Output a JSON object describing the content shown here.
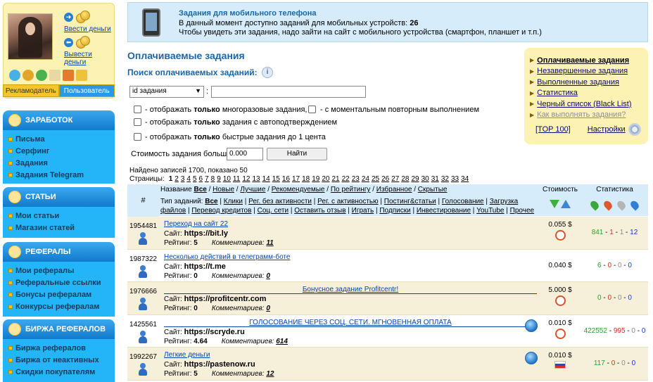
{
  "left": {
    "deposit": "Ввести деньги",
    "withdraw": "Вывести деньги",
    "tab_advertiser": "Рекламодатель",
    "tab_user": "Пользователь",
    "sections": [
      {
        "title": "ЗАРАБОТОК",
        "items": [
          "Письма",
          "Серфинг",
          "Задания",
          "Задания Telegram"
        ]
      },
      {
        "title": "СТАТЬИ",
        "items": [
          "Мои статьи",
          "Магазин статей"
        ]
      },
      {
        "title": "РЕФЕРАЛЫ",
        "items": [
          "Мои рефералы",
          "Реферальные ссылки",
          "Бонусы рефералам",
          "Конкурсы рефералам"
        ]
      },
      {
        "title": "БИРЖА РЕФЕРАЛОВ",
        "items": [
          "Биржа рефералов",
          "Биржа от неактивных",
          "Скидки покупателям"
        ]
      }
    ]
  },
  "banner": {
    "title": "Задания для мобильного телефона",
    "line2_prefix": "В данный момент доступно заданий для мобильных устройств:",
    "line2_count": "26",
    "line3": "Чтобы увидеть эти задания, надо зайти на сайт с мобильного устройства (смартфон, планшет и т.п.)"
  },
  "page_title": "Оплачиваемые задания",
  "search": {
    "title": "Поиск оплачиваемых заданий:",
    "select_value": "id задания",
    "colon": ":",
    "opt1_pre": "- отображать",
    "opt1_bold": "только",
    "opt1_post": "многоразовые задания,",
    "opt1b": "- с моментальным повторным выполнением",
    "opt2_pre": "- отображать",
    "opt2_bold": "только",
    "opt2_post": "задания с автоподтверждением",
    "opt3_pre": "- отображать",
    "opt3_bold": "только",
    "opt3_post": "быстрые задания до 1 цента",
    "cost_label": "Стоимость задания больше",
    "cost_value": "0.000",
    "find_button": "Найти"
  },
  "rightbox": {
    "items": [
      {
        "label": "Оплачиваемые задания",
        "state": "active"
      },
      {
        "label": "Незавершенные задания",
        "state": "normal"
      },
      {
        "label": "Выполненные задания",
        "state": "normal"
      },
      {
        "label": "Статистика",
        "state": "normal"
      },
      {
        "label": "Черный список (Black List)",
        "state": "normal"
      },
      {
        "label": "Как выполнять задания?",
        "state": "dim"
      }
    ],
    "top100": "[TOP 100]",
    "settings": "Настройки"
  },
  "results": {
    "found": "Найдено записей 1700, показано 50",
    "pages_label": "Страницы:",
    "pages": [
      "1",
      "2",
      "3",
      "4",
      "5",
      "6",
      "7",
      "8",
      "9",
      "10",
      "11",
      "12",
      "13",
      "14",
      "15",
      "16",
      "17",
      "18",
      "19",
      "20",
      "21",
      "22",
      "23",
      "24",
      "25",
      "26",
      "27",
      "28",
      "29",
      "30",
      "31",
      "32",
      "33",
      "34"
    ]
  },
  "table_header": {
    "num": "#",
    "name_label": "Название",
    "name_filters": [
      "Все",
      "Новые",
      "Лучшие",
      "Рекомендуемые",
      "По рейтингу",
      "Избранное",
      "Скрытые"
    ],
    "type_label": "Тип заданий:",
    "type_filters": [
      "Все",
      "Клики",
      "Рег. без активности",
      "Рег. с активностью",
      "Постинг&статьи",
      "Голосование",
      "Загрузка файлов",
      "Перевод кредитов",
      "Соц. сети",
      "Оставить отзыв",
      "Играть",
      "Подписки",
      "Инвестирование",
      "YouTube",
      "Прочее"
    ],
    "cost": "Стоимость",
    "stats": "Статистика"
  },
  "rows": [
    {
      "id": "1954481",
      "title": "Переход на сайт 22",
      "site_label": "Сайт:",
      "site": "https://bit.ly",
      "rating_label": "Рейтинг:",
      "rating": "5",
      "comments_label": "Комментариев:",
      "comments": "11",
      "cost": "0.055 $",
      "icon": "clock",
      "globe": false,
      "s1": "841",
      "s2": "1",
      "s3": "1",
      "s4": "12"
    },
    {
      "id": "1987322",
      "title": "Несколько действий в телеграмм-боте",
      "site_label": "Сайт:",
      "site": "https://t.me",
      "rating_label": "Рейтинг:",
      "rating": "0",
      "comments_label": "Комментариев:",
      "comments": "0",
      "cost": "0.040 $",
      "icon": "",
      "globe": false,
      "s1": "6",
      "s2": "0",
      "s3": "0",
      "s4": "0"
    },
    {
      "id": "1976666",
      "title": "Бонусное задание Profitcentr!",
      "site_label": "Сайт:",
      "site": "https://profitcentr.com",
      "rating_label": "Рейтинг:",
      "rating": "0",
      "comments_label": "Комментариев:",
      "comments": "0",
      "cost": "5.000 $",
      "icon": "clock",
      "globe": false,
      "s1": "0",
      "s2": "0",
      "s3": "0",
      "s4": "0"
    },
    {
      "id": "1425561",
      "title": "ГОЛОСОВАНИЕ ЧЕРЕЗ СОЦ. СЕТИ. МГНОВЕННАЯ ОПЛАТА",
      "site_label": "Сайт:",
      "site": "https://scryde.ru",
      "rating_label": "Рейтинг:",
      "rating": "4.64",
      "comments_label": "Комментариев:",
      "comments": "614",
      "cost": "0.010 $",
      "icon": "clock",
      "globe": true,
      "s1": "422552",
      "s2": "995",
      "s3": "0",
      "s4": "0"
    },
    {
      "id": "1992267",
      "title": "Легкие деньги",
      "site_label": "Сайт:",
      "site": "https://pastenow.ru",
      "rating_label": "Рейтинг:",
      "rating": "5",
      "comments_label": "Комментариев:",
      "comments": "12",
      "cost": "0.010 $",
      "icon": "flag",
      "globe": true,
      "s1": "117",
      "s2": "0",
      "s3": "0",
      "s4": "0"
    }
  ],
  "colors": {
    "accent_blue": "#1a66a8",
    "menu_blue": "#23b5f7",
    "card_yellow": "#fbf2b4",
    "row_beige": "#f6efd9"
  }
}
